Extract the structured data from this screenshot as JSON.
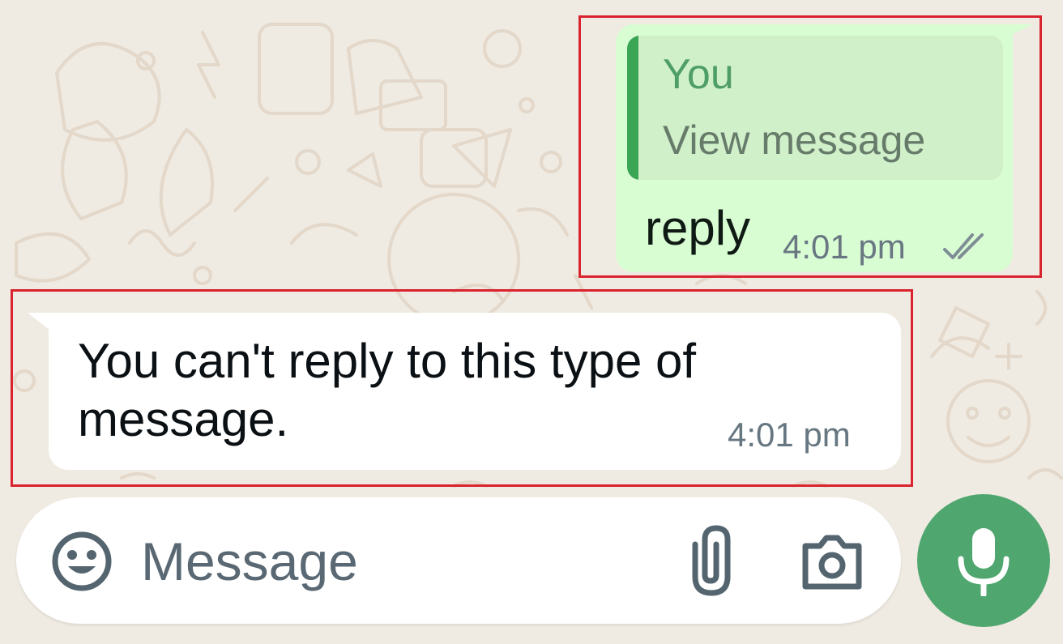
{
  "theme": {
    "accent": "#4fa66f",
    "outgoing_bubble": "#d9fdd3",
    "incoming_bubble": "#ffffff",
    "highlight_border": "#d9232e",
    "wallpaper": "#efeae2"
  },
  "outgoing_message": {
    "quoted": {
      "author": "You",
      "text": "View message"
    },
    "text": "reply",
    "time": "4:01 pm",
    "status_icon": "double-check-icon"
  },
  "incoming_message": {
    "text": "You can't reply to this type of message.",
    "time": "4:01 pm"
  },
  "composer": {
    "placeholder": "Message",
    "emoji_icon": "emoji-icon",
    "attach_icon": "paperclip-icon",
    "camera_icon": "camera-icon"
  },
  "voice_button": {
    "icon": "microphone-icon"
  }
}
